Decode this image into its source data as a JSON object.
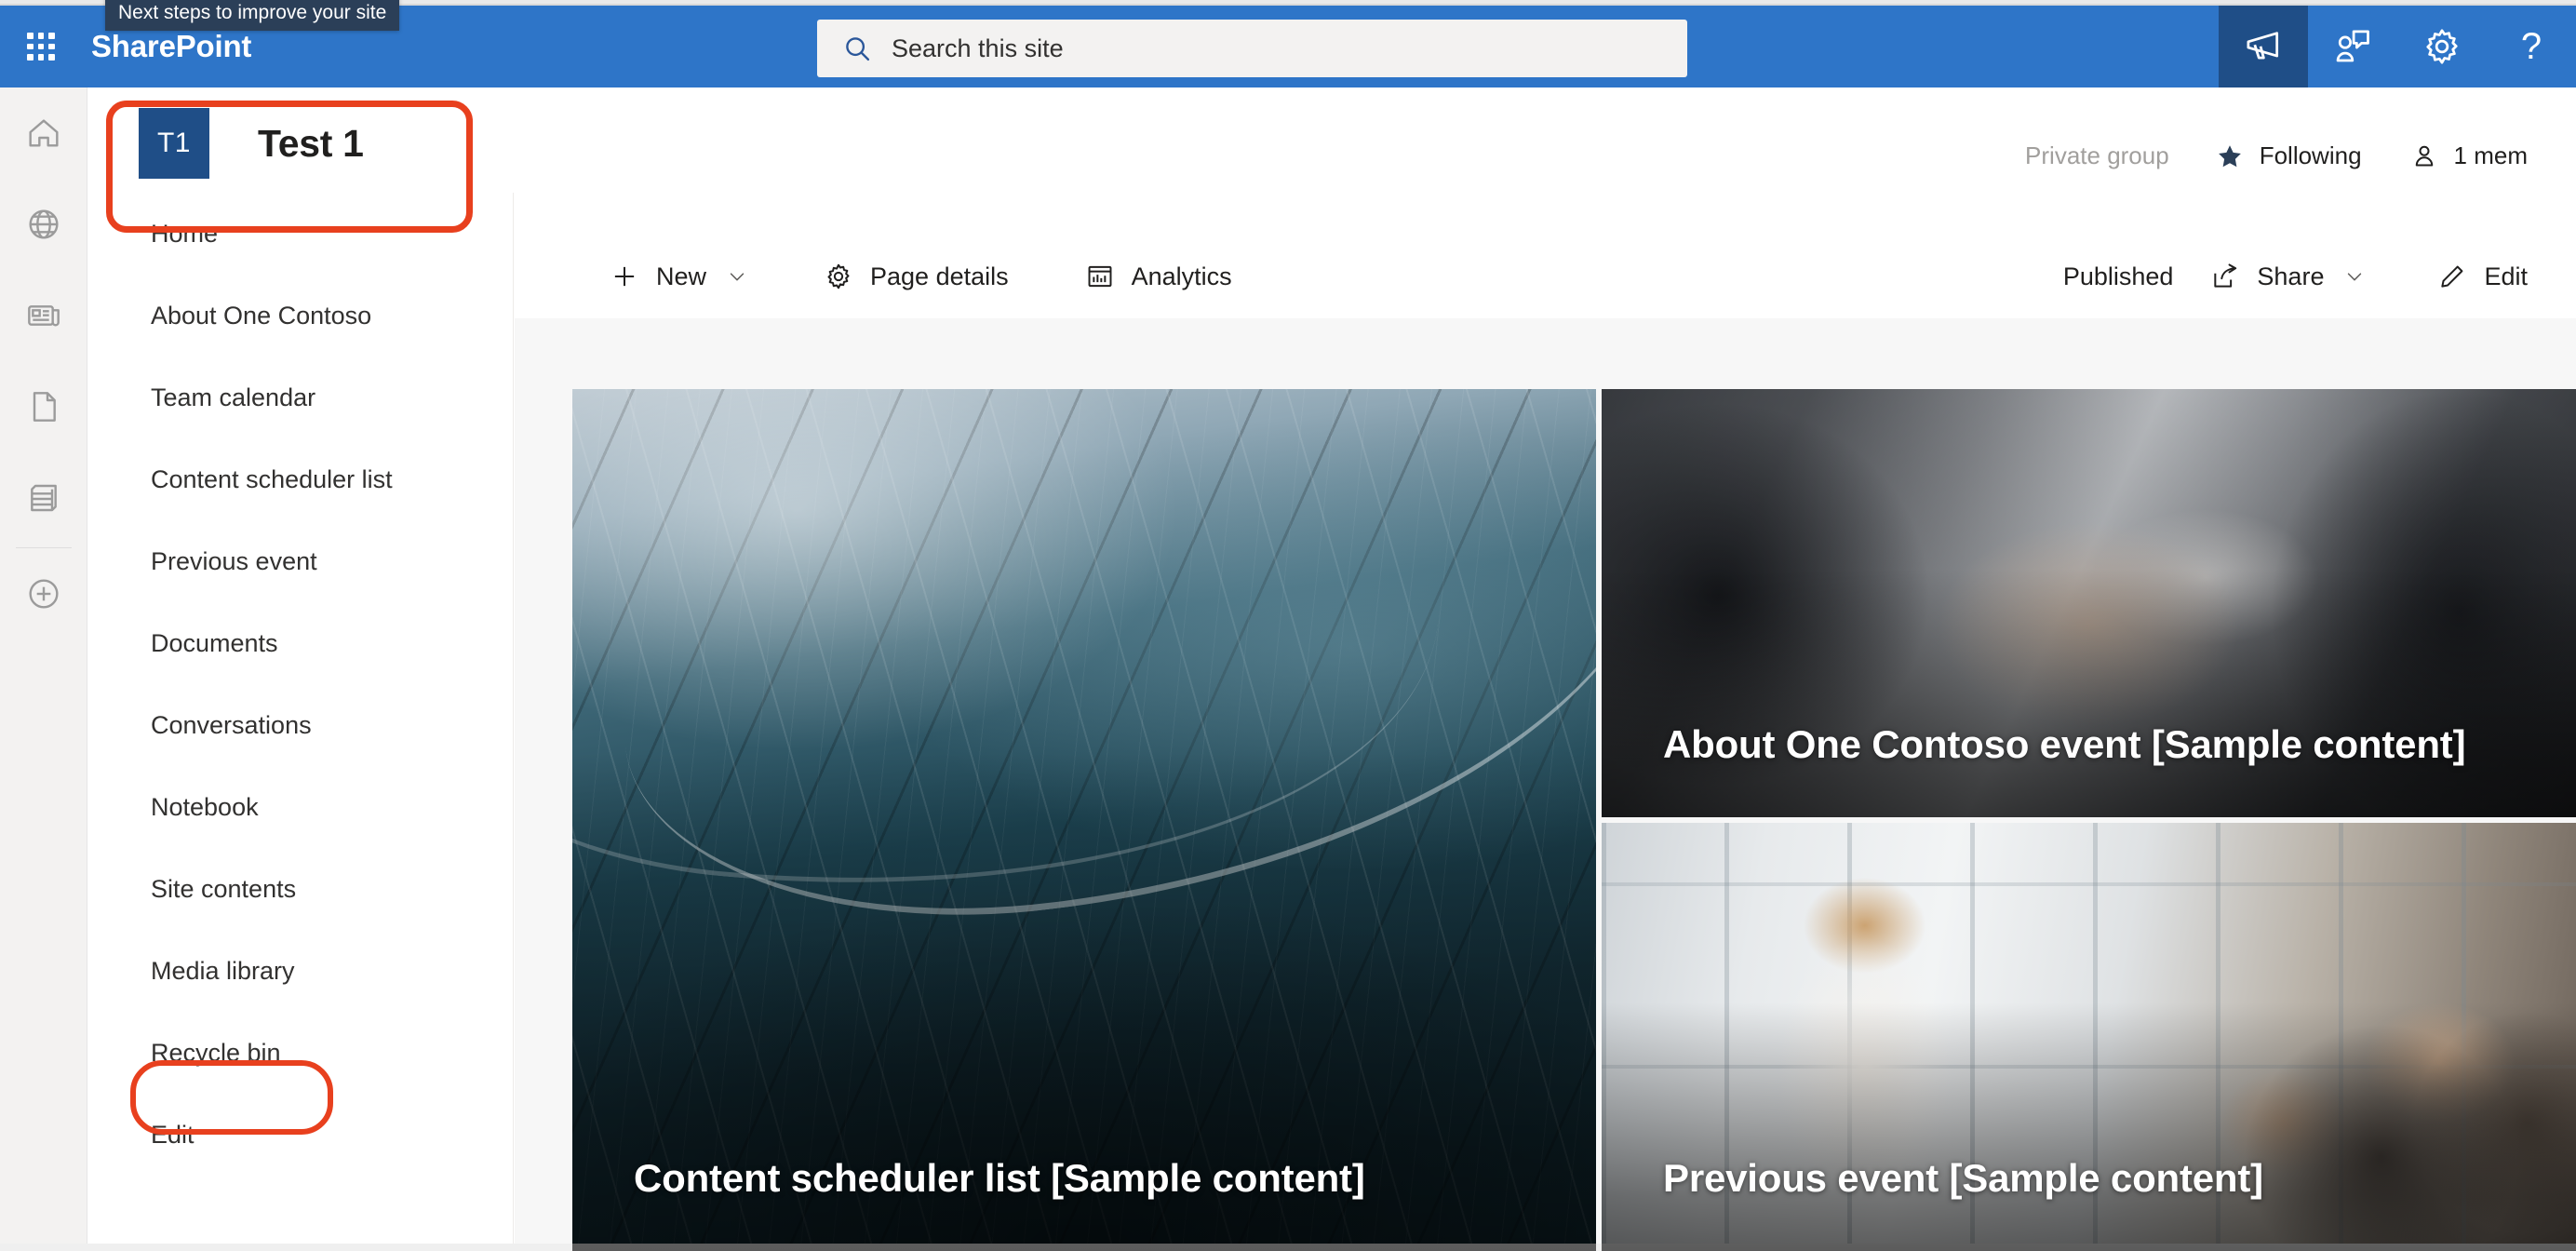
{
  "suite": {
    "brand": "SharePoint",
    "tooltip": "Next steps to improve your site",
    "waffle_icon": "app-launcher-waffle-icon",
    "search": {
      "placeholder": "Search this site",
      "value": "",
      "icon": "search-icon"
    },
    "actions": [
      {
        "name": "announcements",
        "icon": "megaphone-icon",
        "active": true
      },
      {
        "name": "feedback",
        "icon": "person-speech-bubble-icon",
        "active": false
      },
      {
        "name": "settings",
        "icon": "gear-icon",
        "active": false
      },
      {
        "name": "help",
        "icon": "question-mark-icon",
        "label": "?",
        "active": false
      }
    ]
  },
  "rail": {
    "items": [
      {
        "name": "home",
        "icon": "home-icon"
      },
      {
        "name": "my-sites",
        "icon": "globe-icon"
      },
      {
        "name": "news",
        "icon": "news-icon"
      },
      {
        "name": "files",
        "icon": "document-icon"
      },
      {
        "name": "lists",
        "icon": "list-stack-icon"
      }
    ],
    "create": {
      "name": "create",
      "icon": "plus-circle-icon"
    }
  },
  "site": {
    "logo_text": "T1",
    "logo_color": "#1f4e87",
    "title": "Test 1",
    "privacy": "Private group",
    "following": {
      "label": "Following",
      "icon": "star-filled-icon"
    },
    "members": {
      "label": "1 mem",
      "icon": "person-icon"
    }
  },
  "nav": {
    "items": [
      {
        "label": "Home"
      },
      {
        "label": "About One Contoso"
      },
      {
        "label": "Team calendar"
      },
      {
        "label": "Content scheduler list"
      },
      {
        "label": "Previous event"
      },
      {
        "label": "Documents"
      },
      {
        "label": "Conversations"
      },
      {
        "label": "Notebook"
      },
      {
        "label": "Site contents"
      },
      {
        "label": "Media library"
      },
      {
        "label": "Recycle bin"
      },
      {
        "label": "Edit"
      }
    ]
  },
  "commandbar": {
    "new": {
      "label": "New",
      "icon": "plus-icon",
      "chevron": "chevron-down-icon"
    },
    "page_details": {
      "label": "Page details",
      "icon": "gear-icon"
    },
    "analytics": {
      "label": "Analytics",
      "icon": "bar-chart-icon"
    },
    "published": "Published",
    "share": {
      "label": "Share",
      "icon": "share-icon",
      "chevron": "chevron-down-icon"
    },
    "edit": {
      "label": "Edit",
      "icon": "pencil-icon"
    }
  },
  "hero": {
    "tiles": [
      {
        "title": "Content scheduler list [Sample content]",
        "art": "glass-architecture"
      },
      {
        "title": "About One Contoso event [Sample content]",
        "art": "handshake"
      },
      {
        "title": "Previous event [Sample content]",
        "art": "meeting-room"
      }
    ]
  },
  "annotations": {
    "accent": "#e8401e",
    "targets": [
      "site-identity",
      "recycle-bin-nav-item"
    ]
  }
}
